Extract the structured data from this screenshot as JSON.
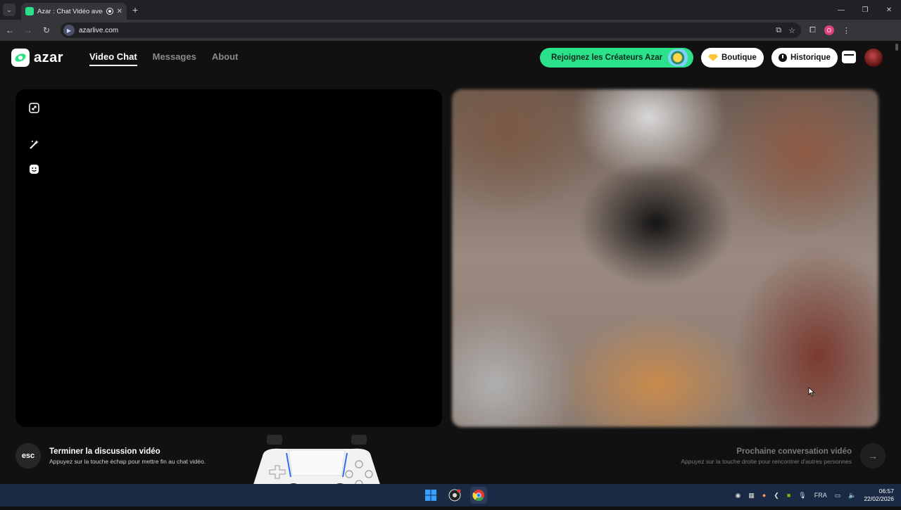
{
  "browser": {
    "tab_title": "Azar : Chat Vidéo avec de n",
    "url": "azarlive.com",
    "profile_initial": "O"
  },
  "header": {
    "logo_text": "azar",
    "nav": [
      {
        "label": "Video Chat",
        "active": true
      },
      {
        "label": "Messages",
        "active": false
      },
      {
        "label": "About",
        "active": false
      }
    ],
    "creators_label": "Rejoignez les Créateurs Azar",
    "shop_label": "Boutique",
    "history_label": "Historique"
  },
  "footer": {
    "esc_key": "esc",
    "end_title": "Terminer la discussion vidéo",
    "end_sub": "Appuyez sur la touche échap pour mettre fin au chat vidéo.",
    "next_title": "Prochaine conversation vidéo",
    "next_sub": "Appuyez sur la touche droite pour rencontrer d'autres personnes"
  },
  "taskbar": {
    "lang": "FRA",
    "time": "06:57",
    "date": "22/02/2026"
  },
  "colors": {
    "accent_green": "#2be18a",
    "page_bg": "#111111",
    "taskbar_bg": "#1a2a44"
  }
}
